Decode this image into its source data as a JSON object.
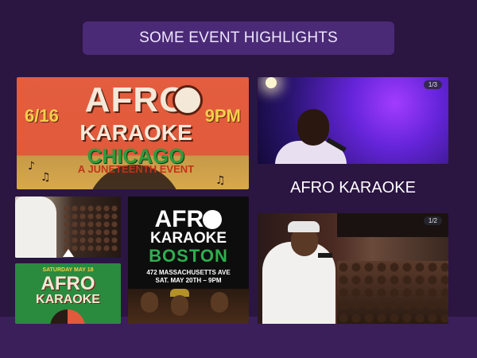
{
  "header": {
    "title": "SOME EVENT HIGHLIGHTS"
  },
  "section": {
    "label": "AFRO KARAOKE"
  },
  "gallery": {
    "chicago_poster": {
      "date": "6/16",
      "time": "9PM",
      "afro": "AFRO",
      "karaoke": "KARAOKE",
      "city": "CHICAGO",
      "subtitle": "A JUNETEENTH EVENT"
    },
    "concert_photo": {
      "counter": "1/3"
    },
    "green_poster": {
      "top_line": "SATURDAY MAY 18",
      "afro": "AFRO",
      "karaoke": "KARAOKE"
    },
    "boston_poster": {
      "afro": "AFRO",
      "karaoke": "KARAOKE",
      "city": "BOSTON",
      "address": "472 MASSACHUSETTS AVE",
      "when": "SAT. MAY 20TH – 9PM"
    },
    "singer_photo": {
      "counter": "1/2"
    }
  },
  "colors": {
    "background": "#2b1541",
    "header_pill": "#4a2a76",
    "footer_band": "#3a1f5a"
  }
}
